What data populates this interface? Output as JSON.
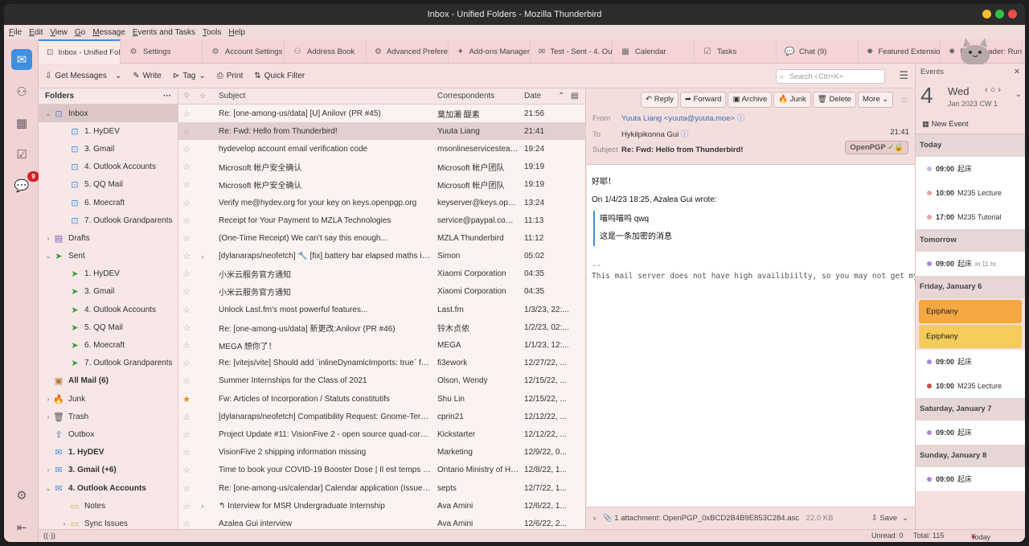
{
  "window": {
    "title": "Inbox - Unified Folders - Mozilla Thunderbird"
  },
  "menu": [
    "File",
    "Edit",
    "View",
    "Go",
    "Message",
    "Events and Tasks",
    "Tools",
    "Help"
  ],
  "spaces": {
    "chat_badge": "9"
  },
  "tabs": [
    {
      "label": "Inbox - Unified Folders",
      "icon": "inbox-icon"
    },
    {
      "label": "Settings",
      "icon": "gear-icon"
    },
    {
      "label": "Account Settings",
      "icon": "gear-icon"
    },
    {
      "label": "Address Book",
      "icon": "address-book-icon"
    },
    {
      "label": "Advanced Preferences",
      "icon": "gear-icon"
    },
    {
      "label": "Add-ons Manager",
      "icon": "puzzle-icon"
    },
    {
      "label": "Test - Sent - 4. Outlook",
      "icon": "mail-icon"
    },
    {
      "label": "Calendar",
      "icon": "calendar-icon"
    },
    {
      "label": "Tasks",
      "icon": "tasks-icon"
    },
    {
      "label": "Chat (9)",
      "icon": "chat-icon"
    },
    {
      "label": "Featured Extensions",
      "icon": "extension-icon"
    },
    {
      "label": "Dark Reader: Run",
      "icon": "extension-icon"
    }
  ],
  "toolbar": {
    "get_messages": "Get Messages",
    "write": "Write",
    "tag": "Tag",
    "print": "Print",
    "quick_filter": "Quick Filter",
    "search_placeholder": "Search <Ctrl+K>"
  },
  "folders": {
    "header": "Folders",
    "items": [
      {
        "label": "Inbox",
        "depth": 0,
        "twisty": "v",
        "icon": "inbox-icon",
        "selected": true
      },
      {
        "label": "1. HyDEV",
        "depth": 1,
        "icon": "inbox-icon"
      },
      {
        "label": "3. Gmail",
        "depth": 1,
        "icon": "inbox-icon"
      },
      {
        "label": "4. Outlook Accounts",
        "depth": 1,
        "icon": "inbox-icon"
      },
      {
        "label": "5. QQ Mail",
        "depth": 1,
        "icon": "inbox-icon"
      },
      {
        "label": "6. Moecraft",
        "depth": 1,
        "icon": "inbox-icon"
      },
      {
        "label": "7. Outlook Grandparents",
        "depth": 1,
        "icon": "inbox-icon"
      },
      {
        "label": "Drafts",
        "depth": 0,
        "twisty": ">",
        "icon": "drafts-icon"
      },
      {
        "label": "Sent",
        "depth": 0,
        "twisty": "v",
        "icon": "sent-icon"
      },
      {
        "label": "1. HyDEV",
        "depth": 1,
        "icon": "sent-icon"
      },
      {
        "label": "3. Gmail",
        "depth": 1,
        "icon": "sent-icon"
      },
      {
        "label": "4. Outlook Accounts",
        "depth": 1,
        "icon": "sent-icon"
      },
      {
        "label": "5. QQ Mail",
        "depth": 1,
        "icon": "sent-icon"
      },
      {
        "label": "6. Moecraft",
        "depth": 1,
        "icon": "sent-icon"
      },
      {
        "label": "7. Outlook Grandparents",
        "depth": 1,
        "icon": "sent-icon"
      },
      {
        "label": "All Mail (6)",
        "depth": 0,
        "icon": "archive-icon",
        "bold": true
      },
      {
        "label": "Junk",
        "depth": 0,
        "twisty": ">",
        "icon": "junk-icon"
      },
      {
        "label": "Trash",
        "depth": 0,
        "twisty": ">",
        "icon": "trash-icon"
      },
      {
        "label": "Outbox",
        "depth": 0,
        "icon": "outbox-icon"
      },
      {
        "label": "1. HyDEV",
        "depth": 0,
        "icon": "account-icon",
        "bold": true
      },
      {
        "label": "3. Gmail (+6)",
        "depth": 0,
        "twisty": ">",
        "icon": "account-icon",
        "bold": true
      },
      {
        "label": "4. Outlook Accounts",
        "depth": 0,
        "twisty": "v",
        "icon": "account-icon",
        "bold": true
      },
      {
        "label": "Notes",
        "depth": 1,
        "icon": "folder-icon"
      },
      {
        "label": "Sync Issues",
        "depth": 1,
        "twisty": ">",
        "icon": "folder-icon"
      }
    ]
  },
  "message_list": {
    "columns": {
      "subject": "Subject",
      "correspondents": "Correspondents",
      "date": "Date"
    },
    "rows": [
      {
        "subject": "Re: [one-among-us/data] [U] Anilovr (PR #45)",
        "from": "葉加瀬 醍素",
        "date": "21:56"
      },
      {
        "subject": "Re: Fwd: Hello from Thunderbird!",
        "from": "Yuuta Liang",
        "date": "21:41",
        "selected": true
      },
      {
        "subject": "hydevelop account email verification code",
        "from": "msonlineservicesteam...",
        "date": "19:24"
      },
      {
        "subject": "Microsoft 帐户安全确认",
        "from": "Microsoft 帐户团队",
        "date": "19:19"
      },
      {
        "subject": "Microsoft 帐户安全确认",
        "from": "Microsoft 帐户团队",
        "date": "19:19"
      },
      {
        "subject": "Verify me@hydev.org for your key on keys.openpgp.org",
        "from": "keyserver@keys.openp...",
        "date": "13:24"
      },
      {
        "subject": "Receipt for Your Payment to MZLA Technologies",
        "from": "service@paypal.com <s...",
        "date": "11:13"
      },
      {
        "subject": "(One-Time Receipt) We can't say this enough...",
        "from": "MZLA Thunderbird",
        "date": "11:12"
      },
      {
        "subject": "[dylanaraps/neofetch] 🔧 [fix] battery bar elapsed maths in...",
        "from": "Simon",
        "date": "05:02",
        "thread": ">"
      },
      {
        "subject": "小米云服务官方通知",
        "from": "Xiaomi Corporation",
        "date": "04:35"
      },
      {
        "subject": "小米云服务官方通知",
        "from": "Xiaomi Corporation",
        "date": "04:35"
      },
      {
        "subject": "Unlock Last.fm's most powerful features...",
        "from": "Last.fm",
        "date": "1/3/23, 22:..."
      },
      {
        "subject": "Re: [one-among-us/data] 新更改:Anilovr (PR #46)",
        "from": "铃木贞依",
        "date": "1/2/23, 02:..."
      },
      {
        "subject": "MEGA 想你了！",
        "from": "MEGA",
        "date": "1/1/23, 12:..."
      },
      {
        "subject": "Re: [vitejs/vite] Should add `inlineDynamicImports: true` for...",
        "from": "fi3ework",
        "date": "12/27/22, ..."
      },
      {
        "subject": "Summer Internships for the Class of 2021",
        "from": "Olson, Wendy",
        "date": "12/15/22, ..."
      },
      {
        "subject": "Fw: Articles of Incorporation / Statuts constitutifs",
        "from": "Shu Lin",
        "date": "12/15/22, ...",
        "starred": true
      },
      {
        "subject": "[dylanaraps/neofetch] Compatibility Request: Gnome-Term...",
        "from": "cprin21",
        "date": "12/12/22, ..."
      },
      {
        "subject": "Project Update #11: VisionFive 2 - open source quad-core R...",
        "from": "Kickstarter",
        "date": "12/12/22, ..."
      },
      {
        "subject": "VisionFive 2 shipping information missing",
        "from": "Marketing",
        "date": "12/9/22, 0..."
      },
      {
        "subject": "Time to book your COVID-19 Booster Dose | Il est temps d...",
        "from": "Ontario Ministry of He...",
        "date": "12/8/22, 1..."
      },
      {
        "subject": "Re: [one-among-us/calendar] Calendar application (Issue #...",
        "from": "septs",
        "date": "12/7/22, 1..."
      },
      {
        "subject": "↰ Interview for MSR Undergraduate Internship",
        "from": "Ava Amini",
        "date": "12/6/22, 1...",
        "thread": ">"
      },
      {
        "subject": "Azalea Gui interview",
        "from": "Ava Amini",
        "date": "12/6/22, 2..."
      }
    ]
  },
  "reader": {
    "buttons": [
      "Reply",
      "Forward",
      "Archive",
      "Junk",
      "Delete",
      "More"
    ],
    "from_label": "From",
    "from": "Yuuta Liang <yuuta@yuuta.moe>",
    "to_label": "To",
    "to": "Hykilpikonna Gui",
    "time": "21:41",
    "subject_label": "Subject",
    "subject": "Re: Fwd: Hello from Thunderbird!",
    "openpgp": "OpenPGP",
    "body_line1": "好耶！",
    "quote_intro": "On 1/4/23 18:25, Azalea Gui wrote:",
    "quote_line1": "喵呜喵呜 qwq",
    "quote_line2": "这是一条加密的消息",
    "sig_sep": "--",
    "sig": "This mail server does not have high availibiilty, so you may not get my",
    "attachment": "1 attachment: OpenPGP_0xBCD2B4B9E853C284.asc",
    "attachment_size": "22.0 KB",
    "save": "Save"
  },
  "today_pane": {
    "title": "Events",
    "day": "4",
    "weekday": "Wed",
    "month": "Jan 2023  CW 1",
    "new_event": "New Event",
    "sections": [
      {
        "header": "Today",
        "events": [
          {
            "time": "09:00",
            "title": "起床",
            "color": "#c9b7e8"
          },
          {
            "time": "10:00",
            "title": "M235 Lecture",
            "color": "#e8a4a4"
          },
          {
            "time": "17:00",
            "title": "M235 Tutorial",
            "color": "#e8a4a4"
          }
        ]
      },
      {
        "header": "Tomorrow",
        "events": [
          {
            "time": "09:00",
            "title": "起床",
            "extra": "in 11 hr.",
            "color": "#a88ad8"
          }
        ]
      },
      {
        "header": "Friday, January 6",
        "allday": [
          {
            "title": "Epiphany",
            "color": "#f5a742"
          },
          {
            "title": "Epiphany",
            "color": "#f5cc5a"
          }
        ],
        "events": [
          {
            "time": "09:00",
            "title": "起床",
            "color": "#a88ad8"
          },
          {
            "time": "10:00",
            "title": "M235 Lecture",
            "color": "#c0504d"
          }
        ]
      },
      {
        "header": "Saturday, January 7",
        "events": [
          {
            "time": "09:00",
            "title": "起床",
            "color": "#a88ad8"
          }
        ]
      },
      {
        "header": "Sunday, January 8",
        "events": [
          {
            "time": "09:00",
            "title": "起床",
            "color": "#a88ad8"
          }
        ]
      }
    ]
  },
  "status": {
    "unread": "Unread: 0",
    "total": "Total: 115",
    "today_pane": "Today Pane"
  }
}
